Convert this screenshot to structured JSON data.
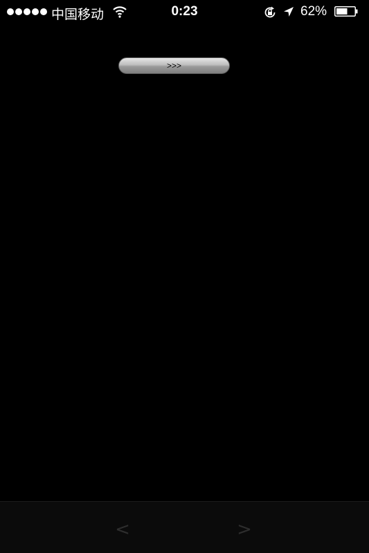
{
  "status_bar": {
    "signal_dots": 5,
    "carrier": "中国移动",
    "time": "0:23",
    "battery_percent": "62%",
    "battery_level": 0.62,
    "icons": [
      "signal-icon",
      "wifi-icon",
      "rotation-lock-icon",
      "location-arrow-icon",
      "battery-icon"
    ]
  },
  "main": {
    "button_label": ">>>"
  },
  "toolbar": {
    "back_label": "<",
    "forward_label": ">"
  },
  "colors": {
    "background": "#000000",
    "toolbar": "#0b0b0b",
    "nav_disabled": "#2e2e2e"
  }
}
